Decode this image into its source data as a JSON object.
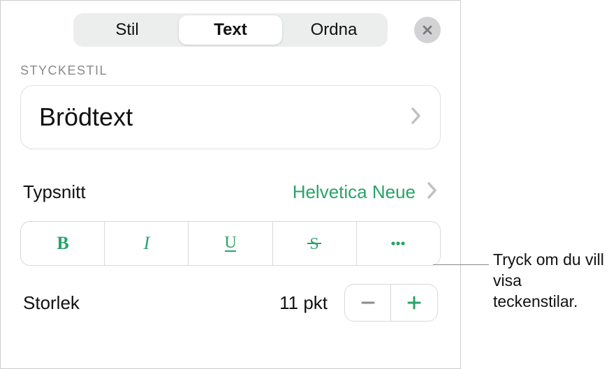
{
  "tabs": {
    "stil": "Stil",
    "text": "Text",
    "ordna": "Ordna"
  },
  "section_label": "STYCKESTIL",
  "paragraph_style": "Brödtext",
  "font": {
    "label": "Typsnitt",
    "value": "Helvetica Neue"
  },
  "size": {
    "label": "Storlek",
    "value": "11",
    "unit": "pkt"
  },
  "callout": "Tryck om du vill visa teckenstilar."
}
